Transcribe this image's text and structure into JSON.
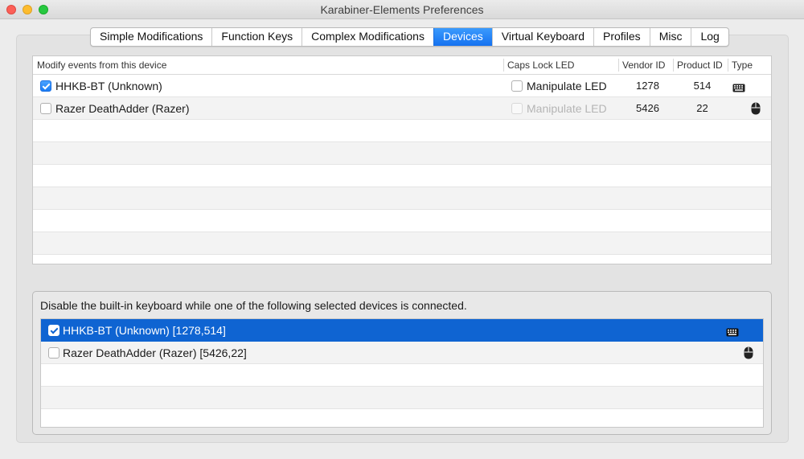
{
  "window": {
    "title": "Karabiner-Elements Preferences"
  },
  "tabs": [
    {
      "label": "Simple Modifications",
      "active": false
    },
    {
      "label": "Function Keys",
      "active": false
    },
    {
      "label": "Complex Modifications",
      "active": false
    },
    {
      "label": "Devices",
      "active": true
    },
    {
      "label": "Virtual Keyboard",
      "active": false
    },
    {
      "label": "Profiles",
      "active": false
    },
    {
      "label": "Misc",
      "active": false
    },
    {
      "label": "Log",
      "active": false
    }
  ],
  "devices_table": {
    "headers": {
      "modify": "Modify events from this device",
      "caps": "Caps Lock LED",
      "vendor": "Vendor ID",
      "product": "Product ID",
      "type": "Type"
    },
    "rows": [
      {
        "name": "HHKB-BT (Unknown)",
        "checked": true,
        "led_label": "Manipulate LED",
        "led_checked": false,
        "led_enabled": true,
        "vendor_id": "1278",
        "product_id": "514",
        "type_icon": "keyboard-icon"
      },
      {
        "name": "Razer DeathAdder (Razer)",
        "checked": false,
        "led_label": "Manipulate LED",
        "led_checked": false,
        "led_enabled": false,
        "vendor_id": "5426",
        "product_id": "22",
        "type_icon": "mouse-icon"
      }
    ]
  },
  "disable_builtin": {
    "label": "Disable the built-in keyboard while one of the following selected devices is connected.",
    "rows": [
      {
        "name": "HHKB-BT (Unknown) [1278,514]",
        "checked": true,
        "selected": true,
        "type_icon": "keyboard-icon"
      },
      {
        "name": "Razer DeathAdder (Razer) [5426,22]",
        "checked": false,
        "selected": false,
        "type_icon": "mouse-icon"
      }
    ]
  },
  "colors": {
    "accent": "#1571f0",
    "selection": "#0f64d2"
  }
}
